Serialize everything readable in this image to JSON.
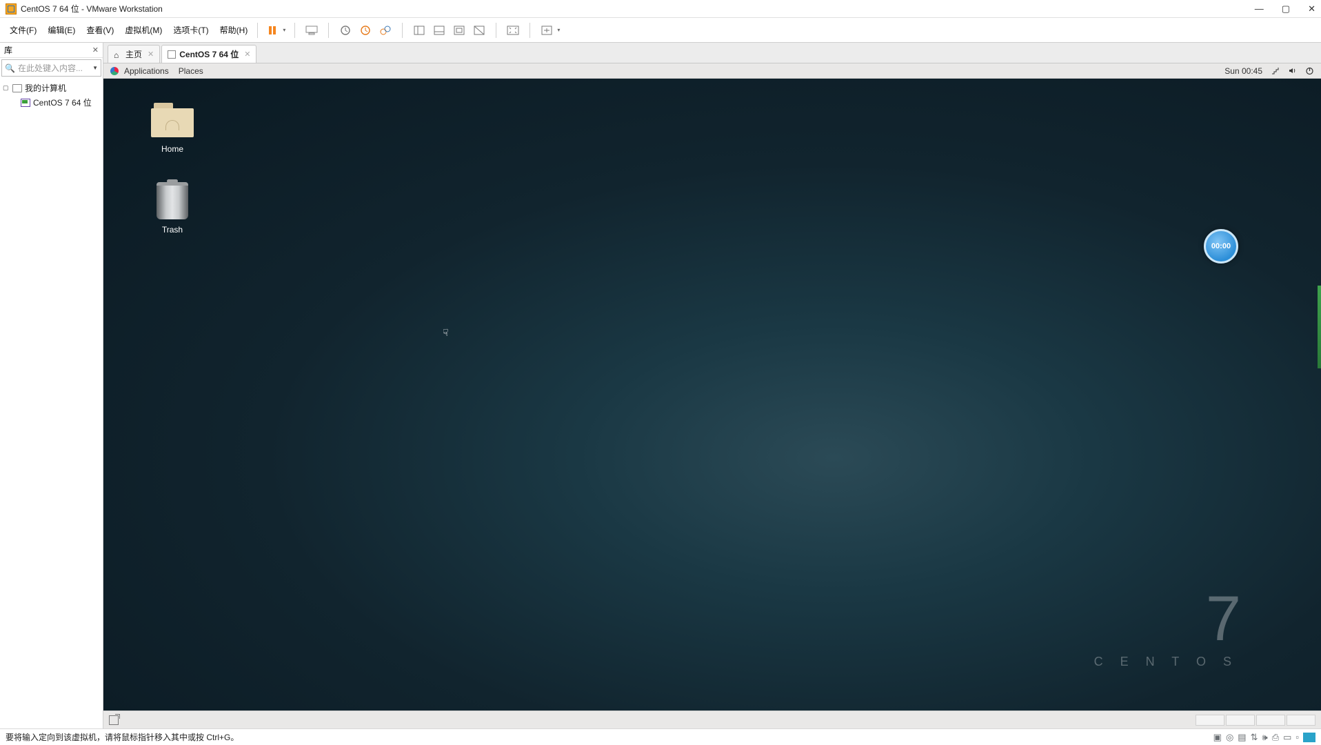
{
  "window": {
    "title": "CentOS 7 64 位 - VMware Workstation",
    "controls": {
      "min": "—",
      "max": "▢",
      "close": "✕"
    }
  },
  "menubar": {
    "file": "文件(F)",
    "edit": "编辑(E)",
    "view": "查看(V)",
    "vm": "虚拟机(M)",
    "tabs": "选项卡(T)",
    "help": "帮助(H)"
  },
  "sidebar": {
    "title": "库",
    "search_placeholder": "在此处键入内容...",
    "root": "我的计算机",
    "vm": "CentOS 7 64 位"
  },
  "vmtabs": {
    "home": "主页",
    "vm": "CentOS 7 64 位"
  },
  "gnome": {
    "applications": "Applications",
    "places": "Places",
    "clock": "Sun 00:45"
  },
  "desktop": {
    "home": "Home",
    "trash": "Trash",
    "brand_num": "7",
    "brand_name": "C E N T O S",
    "timer": "00:00"
  },
  "status": {
    "text": "要将输入定向到该虚拟机，请将鼠标指针移入其中或按 Ctrl+G。"
  }
}
